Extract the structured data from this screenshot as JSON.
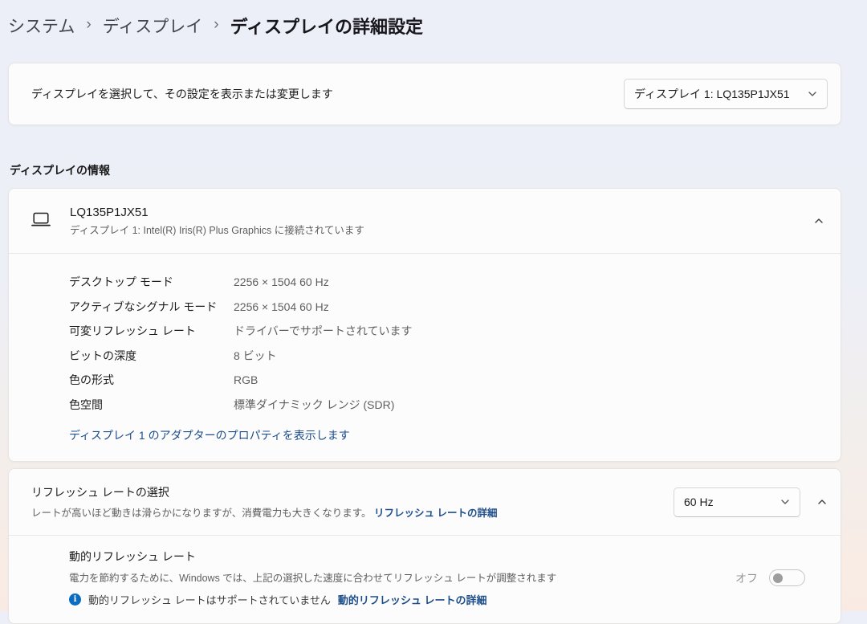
{
  "breadcrumb": {
    "system": "システム",
    "display": "ディスプレイ",
    "current": "ディスプレイの詳細設定",
    "separator": "›"
  },
  "display_selector": {
    "label": "ディスプレイを選択して、その設定を表示または変更します",
    "dropdown_value": "ディスプレイ 1: LQ135P1JX51"
  },
  "display_info": {
    "section_title": "ディスプレイの情報",
    "device_name": "LQ135P1JX51",
    "device_subtitle": "ディスプレイ 1: Intel(R) Iris(R) Plus Graphics に接続されています",
    "rows": [
      {
        "label": "デスクトップ モード",
        "value": "2256 × 1504 60 Hz"
      },
      {
        "label": "アクティブなシグナル モード",
        "value": "2256 × 1504 60 Hz"
      },
      {
        "label": "可変リフレッシュ レート",
        "value": "ドライバーでサポートされています"
      },
      {
        "label": "ビットの深度",
        "value": "8 ビット"
      },
      {
        "label": "色の形式",
        "value": "RGB"
      },
      {
        "label": "色空間",
        "value": "標準ダイナミック レンジ (SDR)"
      }
    ],
    "adapter_link": "ディスプレイ 1 のアダプターのプロパティを表示します"
  },
  "refresh_rate": {
    "title": "リフレッシュ レートの選択",
    "description": "レートが高いほど動きは滑らかになりますが、消費電力も大きくなります。",
    "learn_more_link": "リフレッシュ レートの詳細",
    "dropdown_value": "60 Hz"
  },
  "dynamic_refresh_rate": {
    "title": "動的リフレッシュ レート",
    "description": "電力を節約するために、Windows では、上記の選択した速度に合わせてリフレッシュ レートが調整されます",
    "info_text": "動的リフレッシュ レートはサポートされていません",
    "info_link": "動的リフレッシュ レートの詳細",
    "toggle_state_label": "オフ",
    "toggle_on": false
  },
  "colors": {
    "link_accent": "#1d4e89",
    "info_icon": "#0b6cc1",
    "background_top": "#edeff8",
    "background_bottom": "#f9ebe3"
  }
}
